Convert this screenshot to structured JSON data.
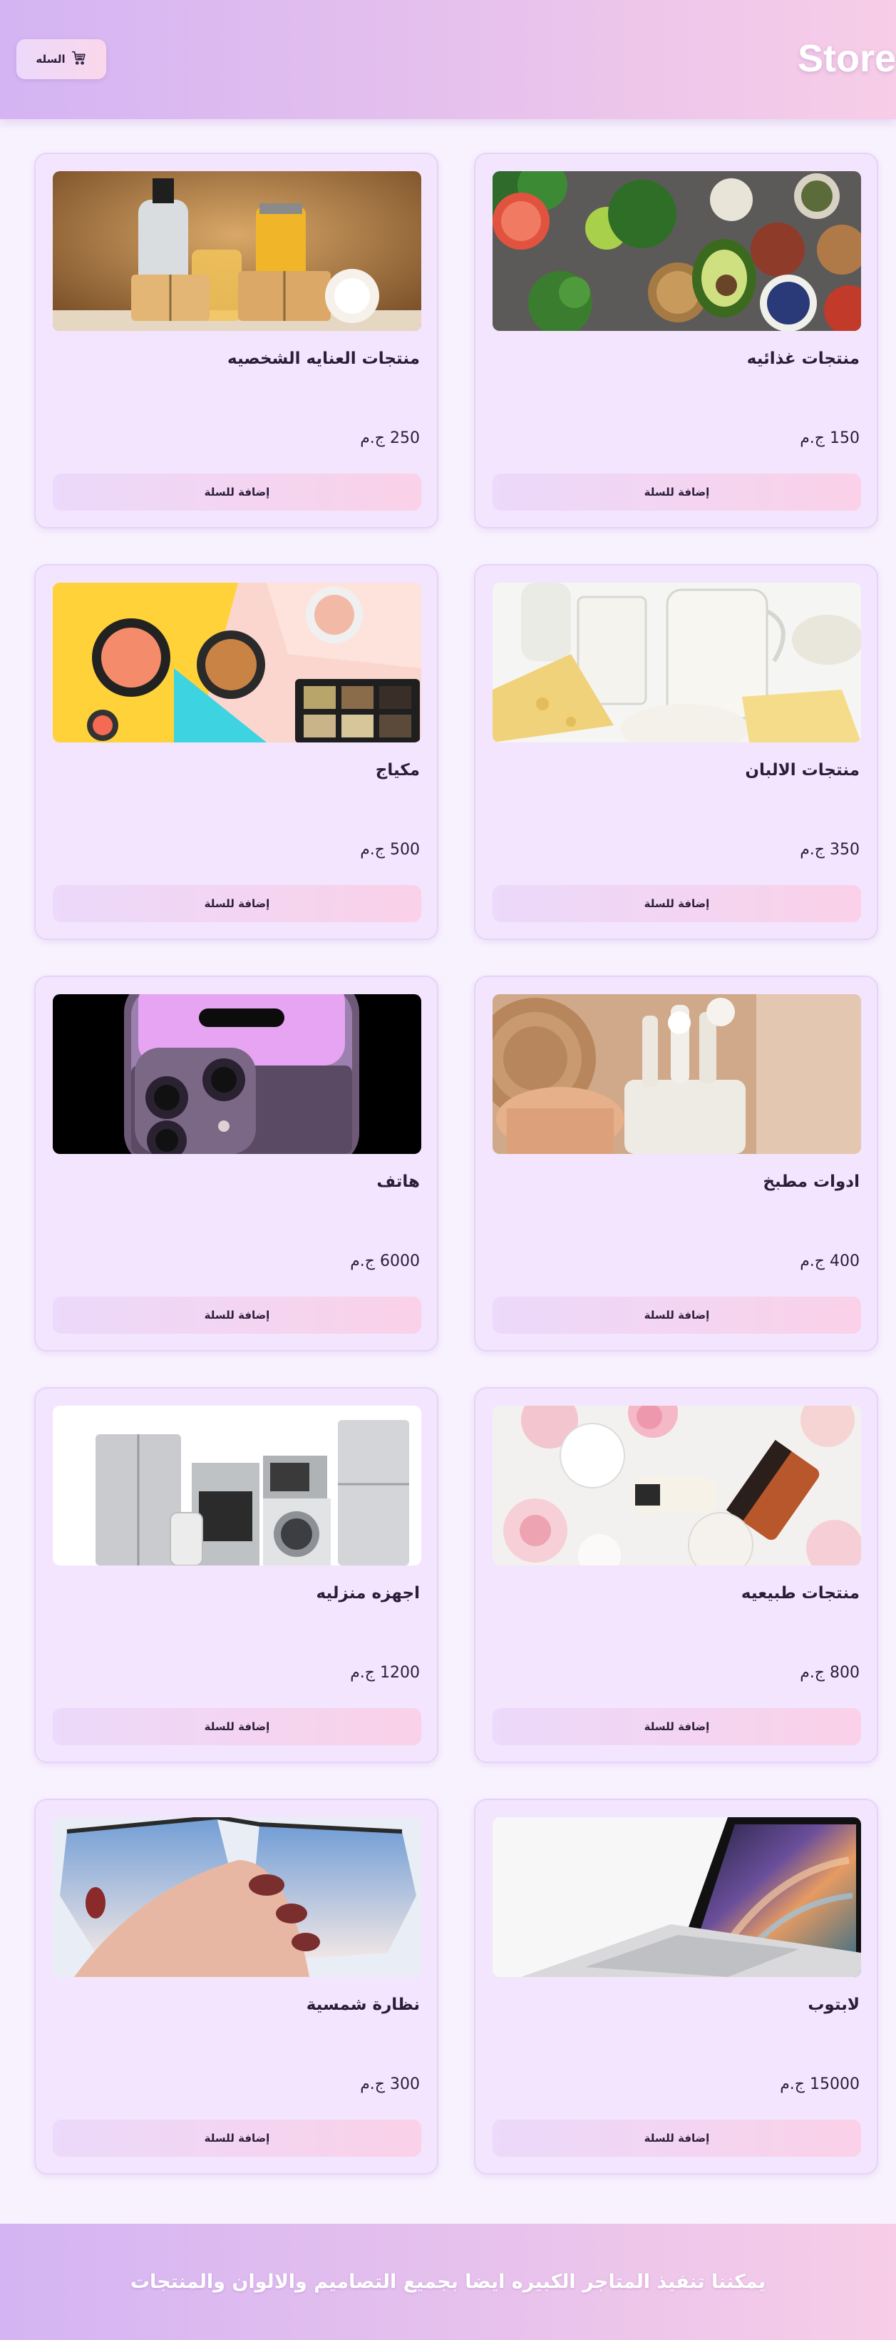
{
  "header": {
    "brand": "Store",
    "cart_label": "السله",
    "cart_icon": "cart-icon"
  },
  "products": [
    {
      "title": "منتجات غذائيه",
      "price": "150 ج.م",
      "button": "إضافة للسلة",
      "image": "food-products"
    },
    {
      "title": "منتجات العنايه الشخصيه",
      "price": "250 ج.م",
      "button": "إضافة للسلة",
      "image": "personal-care"
    },
    {
      "title": "منتجات الالبان",
      "price": "350 ج.م",
      "button": "إضافة للسلة",
      "image": "dairy"
    },
    {
      "title": "مكياج",
      "price": "500 ج.م",
      "button": "إضافة للسلة",
      "image": "makeup"
    },
    {
      "title": "ادوات مطبخ",
      "price": "400 ج.م",
      "button": "إضافة للسلة",
      "image": "kitchen-tools"
    },
    {
      "title": "هاتف",
      "price": "6000 ج.م",
      "button": "إضافة للسلة",
      "image": "phone"
    },
    {
      "title": "منتجات طبيعيه",
      "price": "800 ج.م",
      "button": "إضافة للسلة",
      "image": "natural-products"
    },
    {
      "title": "اجهزه منزليه",
      "price": "1200 ج.م",
      "button": "إضافة للسلة",
      "image": "home-appliances"
    },
    {
      "title": "لابتوب",
      "price": "15000 ج.م",
      "button": "إضافة للسلة",
      "image": "laptop"
    },
    {
      "title": "نظارة شمسية",
      "price": "300 ج.م",
      "button": "إضافة للسلة",
      "image": "sunglasses"
    }
  ],
  "footer": {
    "text": "يمكننا تنفيذ المتاجر الكبيره ايضا بجميع التصاميم والالوان والمنتجات"
  },
  "colors": {
    "header_gradient_start": "#d4b4f3",
    "header_gradient_end": "#f7cde7",
    "card_bg": "#f2e5fd",
    "page_bg": "#f8f2fe",
    "text": "#2b1d3a"
  }
}
